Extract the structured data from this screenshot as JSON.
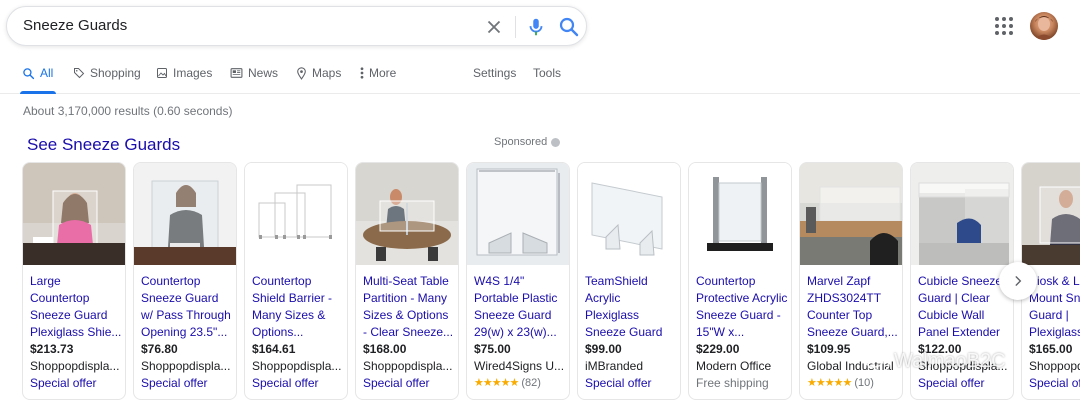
{
  "search": {
    "query": "Sneeze Guards"
  },
  "tabs": [
    {
      "label": "All",
      "icon": "search-icon",
      "active": true
    },
    {
      "label": "Shopping",
      "icon": "tag-icon"
    },
    {
      "label": "Images",
      "icon": "image-icon"
    },
    {
      "label": "News",
      "icon": "news-icon"
    },
    {
      "label": "Maps",
      "icon": "map-pin-icon"
    },
    {
      "label": "More",
      "icon": "more-vert-icon"
    },
    {
      "label": "Settings"
    },
    {
      "label": "Tools"
    }
  ],
  "stats": "About 3,170,000 results (0.60 seconds)",
  "shopping": {
    "title": "See Sneeze Guards",
    "sponsored": "Sponsored",
    "products": [
      {
        "title": "Large Countertop Sneeze Guard Plexiglass Shie...",
        "price": "$213.73",
        "seller": "Shoppopdispla...",
        "extra_type": "offer",
        "extra": "Special offer"
      },
      {
        "title": "Countertop Sneeze Guard w/ Pass Through Opening 23.5\"...",
        "price": "$76.80",
        "seller": "Shoppopdispla...",
        "extra_type": "offer",
        "extra": "Special offer"
      },
      {
        "title": "Countertop Shield Barrier - Many Sizes & Options...",
        "price": "$164.61",
        "seller": "Shoppopdispla...",
        "extra_type": "offer",
        "extra": "Special offer"
      },
      {
        "title": "Multi-Seat Table Partition - Many Sizes & Options - Clear Sneeze...",
        "price": "$168.00",
        "seller": "Shoppopdispla...",
        "extra_type": "offer",
        "extra": "Special offer"
      },
      {
        "title": "W4S 1/4\" Portable Plastic Sneeze Guard 29(w) x 23(w)...",
        "price": "$75.00",
        "seller": "Wired4Signs U...",
        "extra_type": "rating",
        "stars": "★★★★★",
        "extra": "(82)"
      },
      {
        "title": "TeamShield Acrylic Plexiglass Sneeze Guard -...",
        "price": "$99.00",
        "seller": "iMBranded",
        "extra_type": "offer",
        "extra": "Special offer"
      },
      {
        "title": "Countertop Protective Acrylic Sneeze Guard - 15\"W x...",
        "price": "$229.00",
        "seller": "Modern Office",
        "extra_type": "ship",
        "extra": "Free shipping"
      },
      {
        "title": "Marvel Zapf ZHDS3024TT Counter Top Sneeze Guard,...",
        "price": "$109.95",
        "seller": "Global Industrial",
        "extra_type": "rating",
        "stars": "★★★★★",
        "extra": "(10)"
      },
      {
        "title": "Cubicle Sneeze Guard | Clear Cubicle Wall Panel Extender ...",
        "price": "$122.00",
        "seller": "Shoppopdispla...",
        "extra_type": "offer",
        "extra": "Special offer"
      },
      {
        "title": "Kiosk & Lobby Mount Sneeze Guard | Plexiglass...",
        "price": "$165.00",
        "seller": "Shoppopdispla...",
        "extra_type": "offer",
        "extra": "Special offer"
      }
    ]
  },
  "watermark": "WalmaoB2C",
  "colors": {
    "link": "#1a0dab",
    "accent": "#1a73e8",
    "muted": "#70757a",
    "star": "#f9ab00"
  }
}
